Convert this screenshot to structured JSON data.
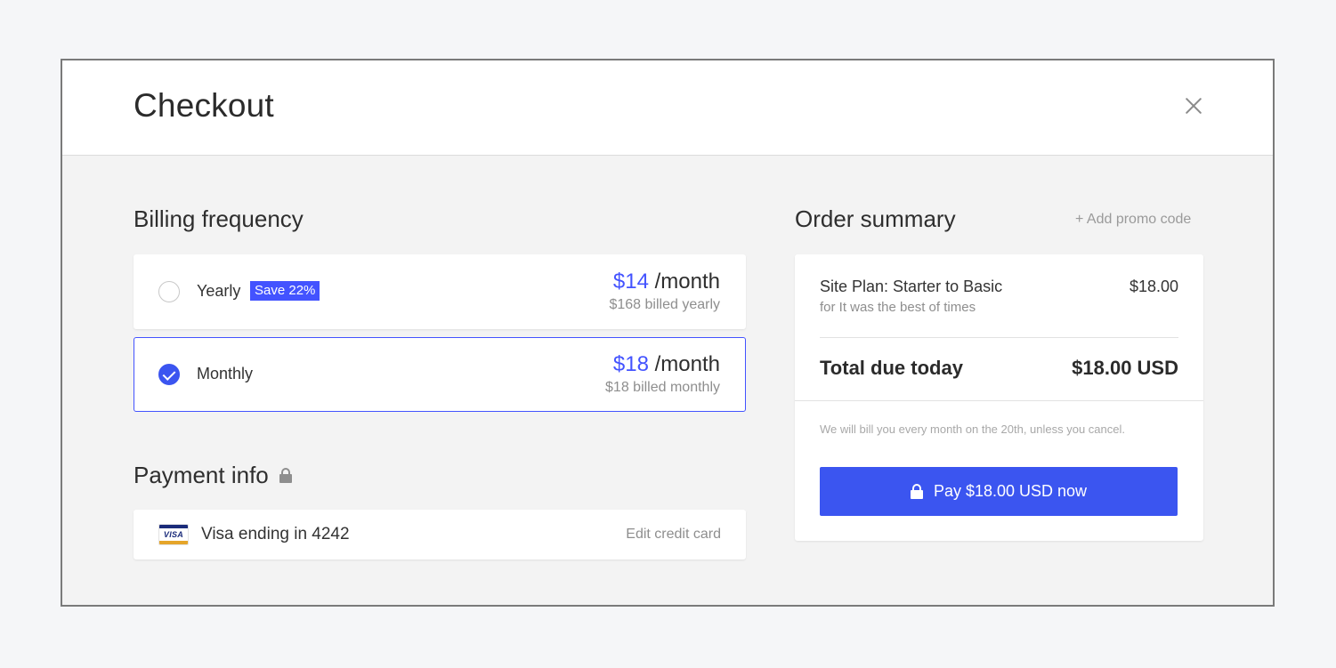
{
  "header": {
    "title": "Checkout",
    "close_icon": "close-icon"
  },
  "billing": {
    "title": "Billing frequency",
    "options": [
      {
        "label": "Yearly",
        "badge": "Save 22%",
        "price_amount": "$14",
        "price_unit": " /month",
        "billed_text": "$168 billed yearly",
        "selected": false
      },
      {
        "label": "Monthly",
        "badge": "",
        "price_amount": "$18",
        "price_unit": " /month",
        "billed_text": "$18 billed monthly",
        "selected": true
      }
    ]
  },
  "payment": {
    "title": "Payment info",
    "card_brand": "VISA",
    "card_label": "Visa ending in 4242",
    "edit_label": "Edit credit card"
  },
  "summary": {
    "title": "Order summary",
    "promo_label": "+ Add promo code",
    "line_item": {
      "name": "Site Plan: Starter to Basic",
      "subtitle": "for It was the best of times",
      "price": "$18.00"
    },
    "total_label": "Total due today",
    "total_value": "$18.00 USD",
    "billing_note": "We will bill you every month on the 20th, unless you cancel.",
    "pay_button_label": "Pay $18.00 USD now"
  },
  "colors": {
    "accent": "#4353ff",
    "button": "#3b55f0",
    "background": "#f3f3f3"
  }
}
